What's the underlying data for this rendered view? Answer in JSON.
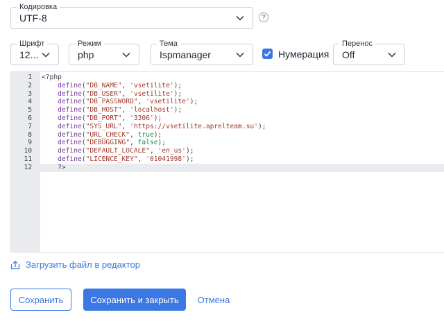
{
  "encoding": {
    "label": "Кодировка",
    "value": "UTF-8"
  },
  "font": {
    "label": "Шрифт",
    "value": "12..."
  },
  "mode": {
    "label": "Режим",
    "value": "php"
  },
  "theme": {
    "label": "Тема",
    "value": "Ispmanager"
  },
  "numbering": {
    "label": "Нумерация",
    "checked": true
  },
  "wrap": {
    "label": "Перенос",
    "value": "Off"
  },
  "help": {
    "glyph": "?"
  },
  "editor": {
    "lines": [
      {
        "num": "1",
        "tokens": [
          [
            "p",
            "<?php"
          ]
        ]
      },
      {
        "num": "2",
        "tokens": [
          [
            "p",
            "    "
          ],
          [
            "fn",
            "define"
          ],
          [
            "p",
            "("
          ],
          [
            "str",
            "\"DB_NAME\""
          ],
          [
            "p",
            ", "
          ],
          [
            "str",
            "'vsetilite'"
          ],
          [
            "p",
            ");"
          ]
        ]
      },
      {
        "num": "3",
        "tokens": [
          [
            "p",
            "    "
          ],
          [
            "fn",
            "define"
          ],
          [
            "p",
            "("
          ],
          [
            "str",
            "\"DB_USER\""
          ],
          [
            "p",
            ", "
          ],
          [
            "str",
            "'vsetilite'"
          ],
          [
            "p",
            ");"
          ]
        ]
      },
      {
        "num": "4",
        "tokens": [
          [
            "p",
            "    "
          ],
          [
            "fn",
            "define"
          ],
          [
            "p",
            "("
          ],
          [
            "str",
            "\"DB_PASSWORD\""
          ],
          [
            "p",
            ", "
          ],
          [
            "str",
            "'vsetilite'"
          ],
          [
            "p",
            ");"
          ]
        ]
      },
      {
        "num": "5",
        "tokens": [
          [
            "p",
            "    "
          ],
          [
            "fn",
            "define"
          ],
          [
            "p",
            "("
          ],
          [
            "str",
            "\"DB_HOST\""
          ],
          [
            "p",
            ", "
          ],
          [
            "str",
            "'localhost'"
          ],
          [
            "p",
            ");"
          ]
        ]
      },
      {
        "num": "6",
        "tokens": [
          [
            "p",
            "    "
          ],
          [
            "fn",
            "define"
          ],
          [
            "p",
            "("
          ],
          [
            "str",
            "\"DB_PORT\""
          ],
          [
            "p",
            ", "
          ],
          [
            "str",
            "'3306'"
          ],
          [
            "p",
            ");"
          ]
        ]
      },
      {
        "num": "7",
        "tokens": [
          [
            "p",
            "    "
          ],
          [
            "fn",
            "define"
          ],
          [
            "p",
            "("
          ],
          [
            "str",
            "\"SYS_URL\""
          ],
          [
            "p",
            ", "
          ],
          [
            "str",
            "'https://vsetilite.aprelteam.su'"
          ],
          [
            "p",
            ");"
          ]
        ]
      },
      {
        "num": "8",
        "tokens": [
          [
            "p",
            "    "
          ],
          [
            "fn",
            "define"
          ],
          [
            "p",
            "("
          ],
          [
            "str",
            "\"URL_CHECK\""
          ],
          [
            "p",
            ", "
          ],
          [
            "kw",
            "true"
          ],
          [
            "p",
            ");"
          ]
        ]
      },
      {
        "num": "9",
        "tokens": [
          [
            "p",
            "    "
          ],
          [
            "fn",
            "define"
          ],
          [
            "p",
            "("
          ],
          [
            "str",
            "\"DEBUGGING\""
          ],
          [
            "p",
            ", "
          ],
          [
            "kw",
            "false"
          ],
          [
            "p",
            ");"
          ]
        ]
      },
      {
        "num": "10",
        "tokens": [
          [
            "p",
            "    "
          ],
          [
            "fn",
            "define"
          ],
          [
            "p",
            "("
          ],
          [
            "str",
            "\"DEFAULT_LOCALE\""
          ],
          [
            "p",
            ", "
          ],
          [
            "str",
            "'en_us'"
          ],
          [
            "p",
            ");"
          ]
        ]
      },
      {
        "num": "11",
        "tokens": [
          [
            "p",
            "    "
          ],
          [
            "fn",
            "define"
          ],
          [
            "p",
            "("
          ],
          [
            "str",
            "\"LICENCE_KEY\""
          ],
          [
            "p",
            ", "
          ],
          [
            "str",
            "'01041998'"
          ],
          [
            "p",
            ");"
          ]
        ]
      },
      {
        "num": "12",
        "tokens": [
          [
            "p",
            "    ?>"
          ]
        ],
        "active": true
      }
    ]
  },
  "upload_link": "Загрузить файл в редактор",
  "buttons": {
    "save": "Сохранить",
    "save_close": "Сохранить и закрыть",
    "cancel": "Отмена"
  },
  "colors": {
    "accent": "#3c78e4",
    "gutter": "#e9ebee"
  }
}
